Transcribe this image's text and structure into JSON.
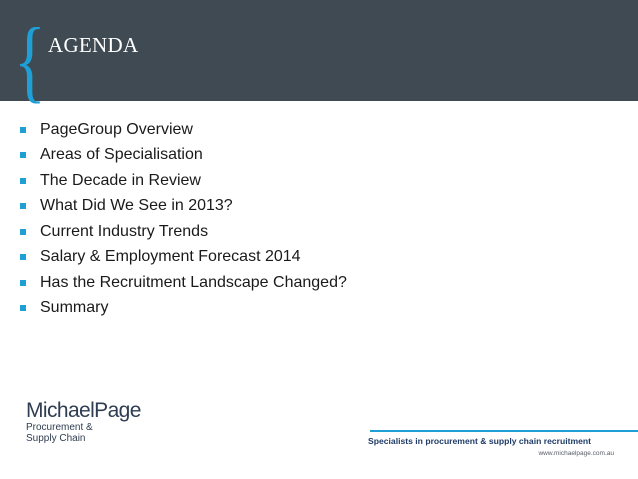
{
  "slide": {
    "title": "AGENDA",
    "brace": "{",
    "items": [
      "PageGroup Overview",
      "Areas of Specialisation",
      "The Decade in Review",
      "What Did We See in 2013?",
      "Current Industry Trends",
      "Salary & Employment Forecast 2014",
      "Has the Recruitment Landscape Changed?",
      "Summary"
    ]
  },
  "footer": {
    "logo_name": "MichaelPage",
    "logo_sub_line1": "Procurement &",
    "logo_sub_line2": "Supply Chain",
    "tagline": "Specialists in procurement & supply chain recruitment",
    "url": "www.michaelpage.com.au"
  },
  "colors": {
    "header_bg": "#3f4a52",
    "accent": "#1e9fd6",
    "brand_navy": "#2f3d52"
  }
}
